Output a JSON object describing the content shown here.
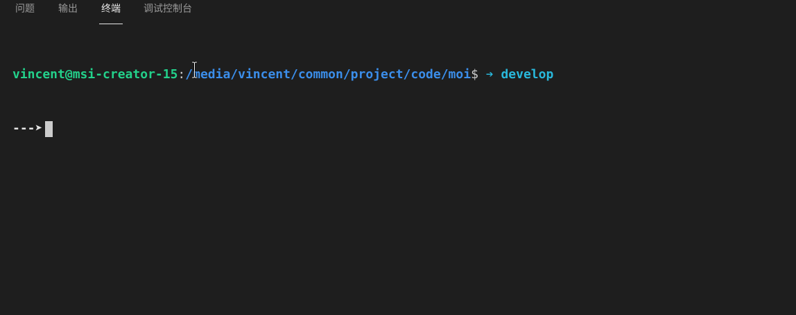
{
  "tabs": [
    {
      "label": "问题",
      "active": false
    },
    {
      "label": "输出",
      "active": false
    },
    {
      "label": "终端",
      "active": true
    },
    {
      "label": "调试控制台",
      "active": false
    }
  ],
  "terminal": {
    "line1": {
      "user_host": "vincent@msi-creator-15",
      "colon": ":",
      "path": "/media/vincent/common/project/code/moi",
      "dollar": "$",
      "arrow": " ➔ ",
      "branch": "develop"
    },
    "line2": {
      "prompt": "---➤"
    }
  },
  "colors": {
    "background": "#1e1e1e",
    "user_host": "#23d18b",
    "path": "#3b8eea",
    "branch": "#29b8db",
    "active_tab": "#e7e7e7",
    "inactive_tab": "#9a9a9a"
  },
  "icons": {
    "mouse_cursor": "text-ibeam-cursor-icon"
  }
}
